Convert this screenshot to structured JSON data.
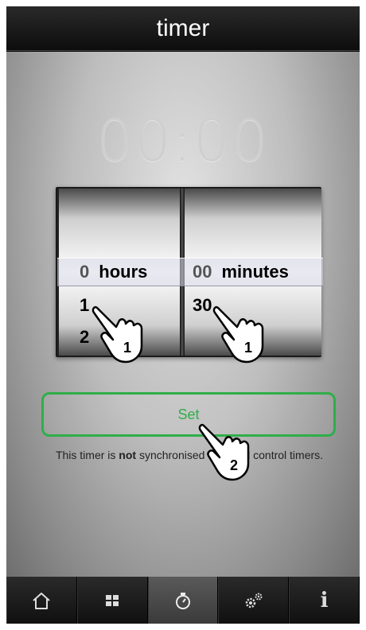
{
  "header": {
    "title": "timer"
  },
  "display": {
    "time": "00:00"
  },
  "picker": {
    "hours": {
      "rows_above": [],
      "selected_value": "0",
      "unit_label": "hours",
      "rows_below": [
        "1",
        "2"
      ]
    },
    "minutes": {
      "rows_above": [],
      "selected_value": "00",
      "unit_label": "minutes",
      "rows_below": [
        "30"
      ]
    }
  },
  "set_button": {
    "label": "Set"
  },
  "note": {
    "prefix": "This timer is ",
    "emphasis": "not",
    "suffix": " synchronised with wall control timers."
  },
  "tabbar": {
    "items": [
      {
        "icon": "home-icon"
      },
      {
        "icon": "grid-icon"
      },
      {
        "icon": "timer-icon",
        "active": true
      },
      {
        "icon": "gears-icon"
      },
      {
        "icon": "info-icon",
        "glyph": "i"
      }
    ]
  },
  "annotations": {
    "hand_hours_number": "1",
    "hand_minutes_number": "1",
    "hand_set_number": "2"
  },
  "colors": {
    "accent": "#2fae49"
  }
}
